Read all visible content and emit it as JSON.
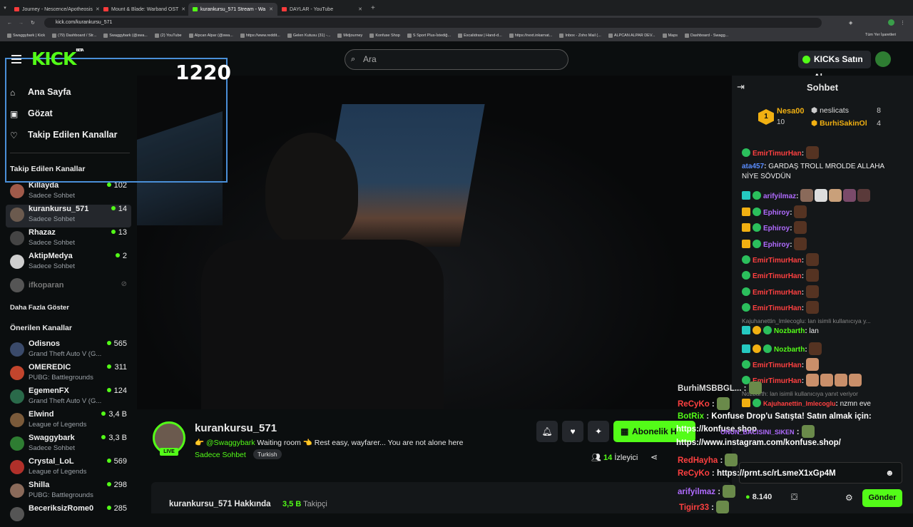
{
  "browser": {
    "tabs": [
      {
        "title": "Journey - Nescence/Apotheosis",
        "color": "#ff3b3b"
      },
      {
        "title": "Mount & Blade: Warband OST",
        "color": "#ff3b3b"
      },
      {
        "title": "kurankursu_571 Stream - Wa",
        "color": "#53fc18"
      },
      {
        "title": "DAYLAR - YouTube",
        "color": "#ff3b3b"
      }
    ],
    "url": "kick.com/kurankursu_571",
    "bookmarks": [
      "Swaggybark | Kick",
      "(79) Dashboard / Str...",
      "Swaggybark (@swa...",
      "(2) YouTube",
      "Alpcan Alpar (@swa...",
      "https://www.reddit...",
      "Gelen Kutusu (31) -...",
      "Midjourney",
      "Konfuse Shop",
      "S Sport Plus-İstediğ...",
      "Excalidraw | Hand-d...",
      "https://next.inkarnat...",
      "Inbox - Zoho Mail (...",
      "ALPCAN ALPAR DEV...",
      "Maps",
      "Dashboard - Swagg..."
    ],
    "all_bookmarks": "Tüm Yer İşaretleri"
  },
  "header": {
    "logo": "KICK",
    "logo_tag": "BETA",
    "search_placeholder": "Ara",
    "kicks_button": "KICKs Satın Al"
  },
  "overlay_counter": "1220",
  "sidebar": {
    "nav": [
      "Ana Sayfa",
      "Gözat",
      "Takip Edilen Kanallar"
    ],
    "following_title": "Takip Edilen Kanallar",
    "following": [
      {
        "name": "Killayda",
        "sub": "Sadece Sohbet",
        "count": "102"
      },
      {
        "name": "kurankursu_571",
        "sub": "Sadece Sohbet",
        "count": "14"
      },
      {
        "name": "Rhazaz",
        "sub": "Sadece Sohbet",
        "count": "13"
      },
      {
        "name": "AktipMedya",
        "sub": "Sadece Sohbet",
        "count": "2"
      }
    ],
    "offline": "ifkoparan",
    "show_more": "Daha Fazla Göster",
    "recommended_title": "Önerilen Kanallar",
    "recommended": [
      {
        "name": "Odisnos",
        "sub": "Grand Theft Auto V (G...",
        "count": "565"
      },
      {
        "name": "OMEREDIC",
        "sub": "PUBG: Battlegrounds",
        "count": "311"
      },
      {
        "name": "EgemenFX",
        "sub": "Grand Theft Auto V (G...",
        "count": "124"
      },
      {
        "name": "Elwind",
        "sub": "League of Legends",
        "count": "3,4 B"
      },
      {
        "name": "Swaggybark",
        "sub": "Sadece Sohbet",
        "count": "3,3 B"
      },
      {
        "name": "Crystal_LoL",
        "sub": "League of Legends",
        "count": "569"
      },
      {
        "name": "Shilla",
        "sub": "PUBG: Battlegrounds",
        "count": "298"
      },
      {
        "name": "BeceriksizRome0",
        "sub": "",
        "count": "285"
      }
    ]
  },
  "stream": {
    "channel": "kurankursu_571",
    "live_badge": "LIVE",
    "title_mention": "@Swaggybark",
    "title_text": "Waiting room 👈 Rest easy, wayfarer... You are not alone here",
    "category": "Sadece Sohbet",
    "language": "Turkish",
    "viewers": "14",
    "viewers_label": "İzleyici",
    "subscribe_label": "Abonelik H",
    "about_title": "kurankursu_571 Hakkında",
    "followers": "3,5 B",
    "followers_label": "Takipçi"
  },
  "chat": {
    "title": "Sohbet",
    "top_gifters": [
      {
        "rank": "1",
        "name": "Nesa00",
        "count": "10"
      },
      {
        "name": "neslicats",
        "count": "8"
      },
      {
        "name": "BurhiSakinOl",
        "count": "4"
      }
    ],
    "messages": [
      {
        "user": "EmirTimurHan",
        "color": "#ff4040",
        "text": ""
      },
      {
        "user": "ata457",
        "color": "#5a8dff",
        "text": "GARDAŞ TROLL MROLDE ALLAHA"
      },
      {
        "user": "",
        "color": "#eeeeee",
        "text": "NİYE SÖVDÜN"
      },
      {
        "user": "arifyilmaz",
        "color": "#b06bff",
        "text": ""
      },
      {
        "user": "Ephiroy",
        "color": "#b06bff",
        "text": ""
      },
      {
        "user": "Ephiroy",
        "color": "#b06bff",
        "text": ""
      },
      {
        "user": "Ephiroy",
        "color": "#b06bff",
        "text": ""
      },
      {
        "user": "EmirTimurHan",
        "color": "#ff4040",
        "text": ""
      },
      {
        "user": "EmirTimurHan",
        "color": "#ff4040",
        "text": ""
      },
      {
        "user": "EmirTimurHan",
        "color": "#ff4040",
        "text": ""
      },
      {
        "user": "EmirTimurHan",
        "color": "#ff4040",
        "text": ""
      }
    ],
    "reply_note_1": "Kajuhanettin_lmlecoglu: lan isimli kullanıcıya y...",
    "reply_msg_1_user": "Nozbarth",
    "reply_msg_1_text": "lan",
    "reply_msg_2_user": "Nozbarth",
    "more_emir": [
      "EmirTimurHan",
      "EmirTimurHan"
    ],
    "reply_note_2": "Nozbarth: lan isimli kullanıcıya yanıt veriyor",
    "kaju_user": "Kajuhanettin_lmlecoglu",
    "kaju_text": "nzmn eve",
    "kicks_balance": "8.140",
    "send_label": "Gönder"
  },
  "overlay_chat": {
    "lines": [
      {
        "user": "BurhiMSBBGL...",
        "text": ""
      },
      {
        "user": "ReCyKo",
        "text": ""
      },
      {
        "user": "BotRix",
        "text": "Konfuse Drop'u Satışta! Satın almak için:"
      },
      {
        "user": "",
        "text": "https://konfuse.shop"
      },
      {
        "user": "ONUN_BACISINI_SIKEN",
        "text": ""
      },
      {
        "user": "",
        "text": "https://www.instagram.com/konfuse.shop/"
      },
      {
        "user": "RedHayha",
        "text": ""
      },
      {
        "user": "ReCyKo",
        "text": "https://prnt.sc/rLsmeX1xGp4M"
      },
      {
        "user": "arifyilmaz",
        "text": ""
      },
      {
        "user": "Tigirr33",
        "text": ""
      }
    ]
  }
}
